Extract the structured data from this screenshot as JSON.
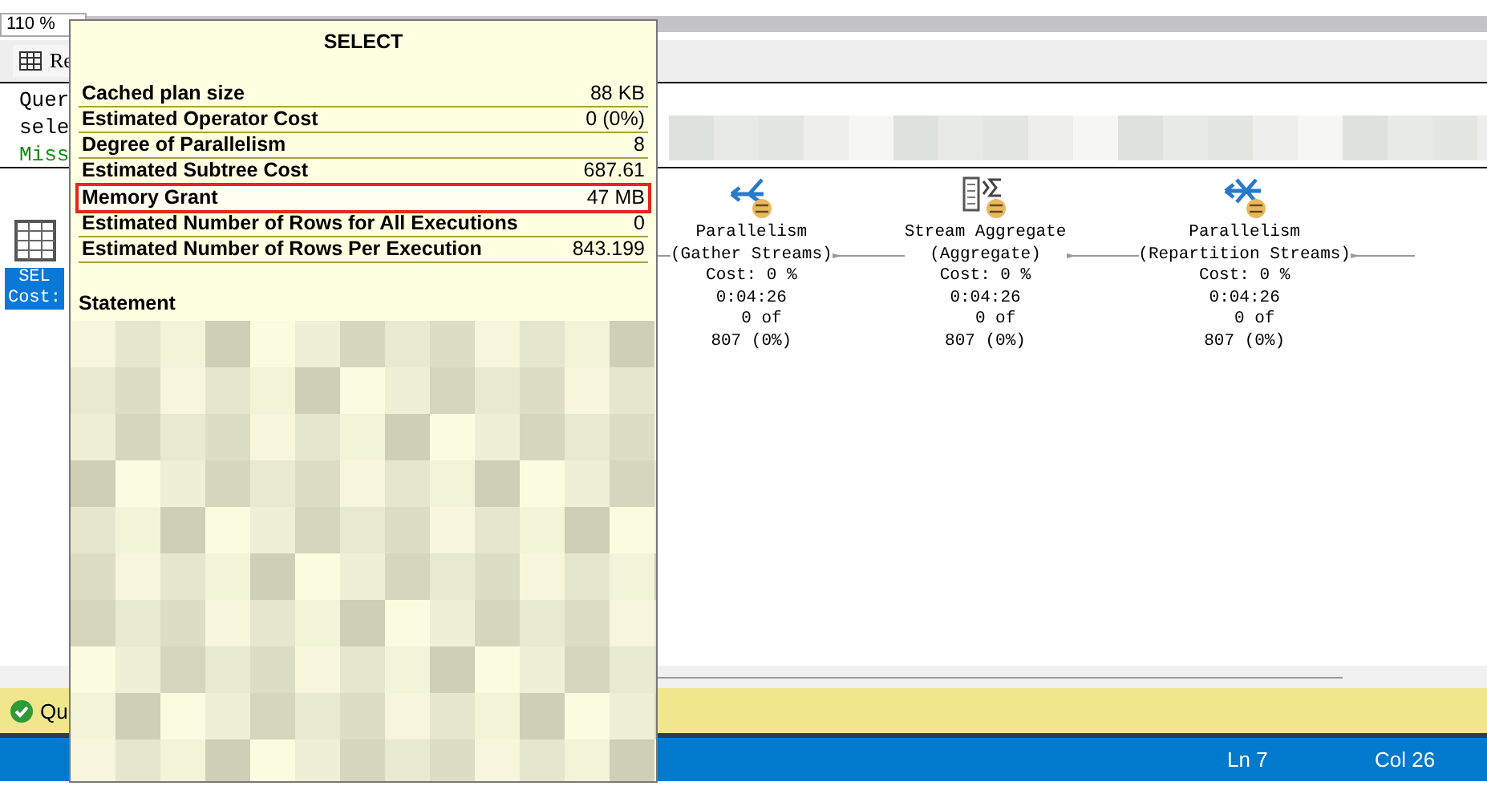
{
  "zoom": "110 %",
  "results_tab": "Re",
  "messages": [
    {
      "text": "Quer",
      "kind": "plain"
    },
    {
      "text": "sele",
      "kind": "plain"
    },
    {
      "text": "Miss",
      "kind": "hint"
    }
  ],
  "plan": {
    "root": {
      "lines": [
        "SEL",
        "Cost:"
      ],
      "selected": true
    },
    "nodes": [
      {
        "kind": "gather",
        "name": "Parallelism",
        "subtitle": "(Gather Streams)",
        "cost": "Cost: 0 %",
        "time": "0:04:26",
        "rows": "0 of",
        "rows_total": "807 (0%)"
      },
      {
        "kind": "aggregate",
        "name": "Stream Aggregate",
        "subtitle": "(Aggregate)",
        "cost": "Cost: 0 %",
        "time": "0:04:26",
        "rows": "0 of",
        "rows_total": "807 (0%)"
      },
      {
        "kind": "repartition",
        "name": "Parallelism",
        "subtitle": "(Repartition Streams)",
        "cost": "Cost: 0 %",
        "time": "0:04:26",
        "rows": "0 of",
        "rows_total": "807 (0%)"
      }
    ]
  },
  "status": {
    "message": "Qu",
    "ln": "Ln 7",
    "col": "Col 26"
  },
  "tooltip": {
    "title": "SELECT",
    "properties": [
      {
        "name": "Cached plan size",
        "value": "88 KB",
        "highlighted": false
      },
      {
        "name": "Estimated Operator Cost",
        "value": "0 (0%)",
        "highlighted": false
      },
      {
        "name": "Degree of Parallelism",
        "value": "8",
        "highlighted": false
      },
      {
        "name": "Estimated Subtree Cost",
        "value": "687.61",
        "highlighted": false
      },
      {
        "name": "Memory Grant",
        "value": "47 MB",
        "highlighted": true
      },
      {
        "name": "Estimated Number of Rows for All Executions",
        "value": "0",
        "highlighted": false
      },
      {
        "name": "Estimated Number of Rows Per Execution",
        "value": "843.199",
        "highlighted": false
      }
    ],
    "statement_label": "Statement"
  }
}
